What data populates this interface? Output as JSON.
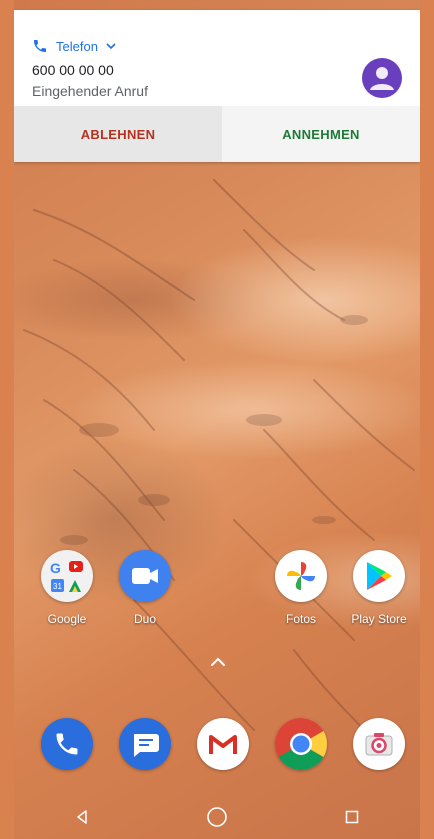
{
  "notification": {
    "app_name": "Telefon",
    "caller_number": "600 00 00 00",
    "call_status": "Eingehender Anruf",
    "decline_label": "ABLEHNEN",
    "accept_label": "ANNEHMEN",
    "app_color": "#1e72e5",
    "decline_color": "#b5331e",
    "accept_color": "#1f7a36",
    "avatar_color": "#6a3fbe"
  },
  "home_apps": [
    {
      "label": "Google",
      "icon": "google-folder-icon"
    },
    {
      "label": "Duo",
      "icon": "duo-icon"
    },
    {
      "label": "Fotos",
      "icon": "photos-icon"
    },
    {
      "label": "Play Store",
      "icon": "play-store-icon"
    }
  ],
  "dock_apps": [
    {
      "icon": "phone-icon"
    },
    {
      "icon": "messages-icon"
    },
    {
      "icon": "gmail-icon"
    },
    {
      "icon": "chrome-icon"
    },
    {
      "icon": "camera-icon"
    }
  ],
  "navigation": {
    "back": "back-icon",
    "home": "home-icon",
    "recents": "recents-icon"
  }
}
